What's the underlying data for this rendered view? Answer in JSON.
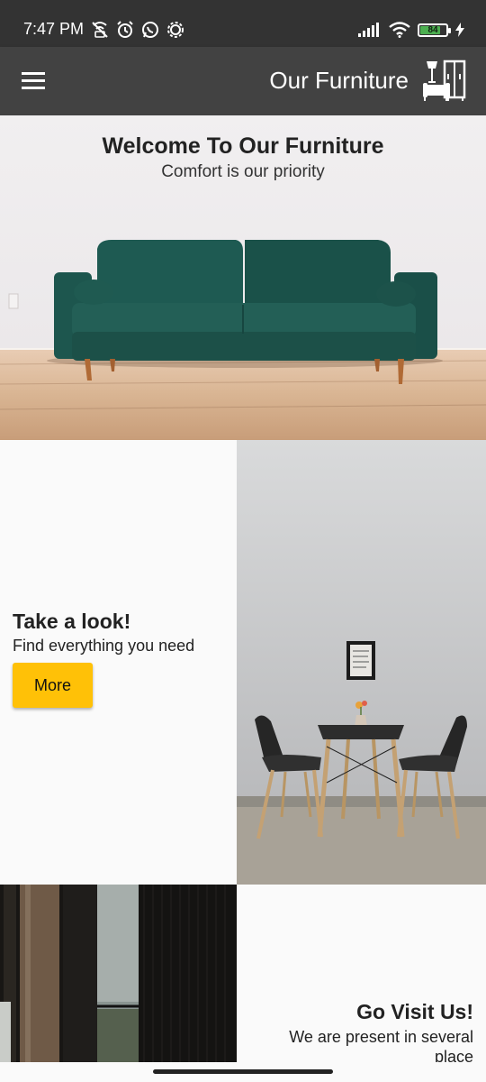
{
  "status_bar": {
    "time": "7:47 PM",
    "battery_level": "84",
    "battery_fraction": 0.84,
    "icons": [
      "wifi-calling-off-icon",
      "alarm-icon",
      "whatsapp-icon",
      "settings-icon",
      "signal-icon",
      "wifi-icon",
      "battery-icon",
      "charging-icon"
    ]
  },
  "app_bar": {
    "title": "Our Furniture",
    "menu_icon": "menu-icon",
    "logo_icon": "furniture-logo-icon",
    "background": "#424242"
  },
  "hero": {
    "title": "Welcome To Our Furniture",
    "subtitle": "Comfort is our priority"
  },
  "look_section": {
    "title": "Take a look!",
    "subtitle": "Find everything you need",
    "button_label": "More",
    "button_color": "#ffc107"
  },
  "visit_section": {
    "title": "Go Visit Us!",
    "subtitle": "We are present in several place"
  }
}
